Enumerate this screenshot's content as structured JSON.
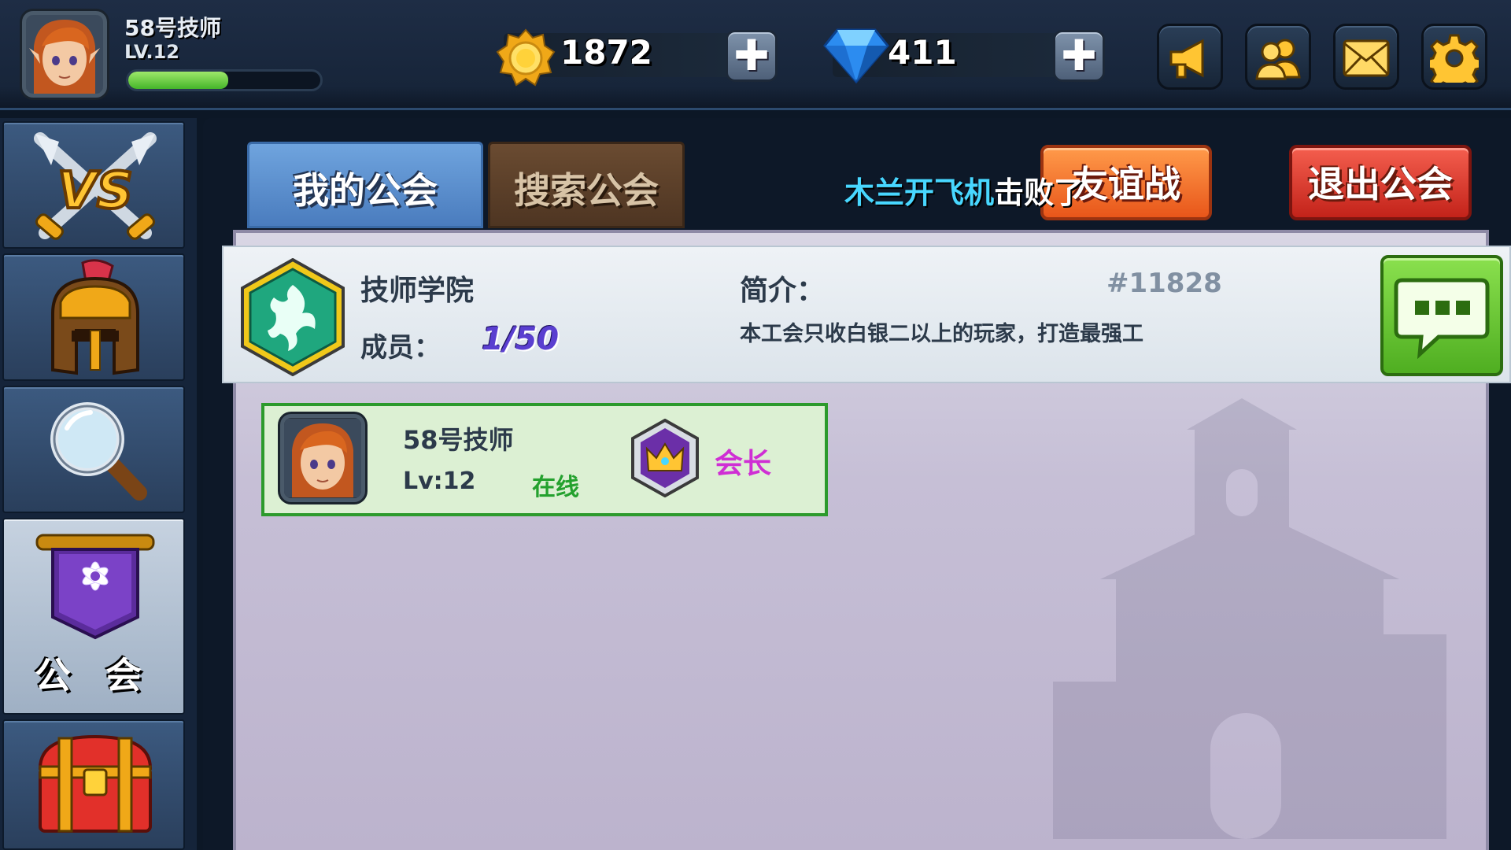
{
  "player": {
    "name": "58号技师",
    "level": "LV.12",
    "xp_fraction": 0.52
  },
  "currency": {
    "gold": "1872",
    "diamonds": "411",
    "plus_symbol": "✚"
  },
  "top_icons": [
    "megaphone-icon",
    "friends-icon",
    "mail-icon",
    "settings-gear-icon"
  ],
  "sidebar": {
    "items": [
      {
        "name": "battle-vs",
        "icon": "vs-swords-icon",
        "label": ""
      },
      {
        "name": "heroes",
        "icon": "helmet-icon",
        "label": ""
      },
      {
        "name": "search",
        "icon": "magnifier-icon",
        "label": ""
      },
      {
        "name": "guild",
        "icon": "guild-banner-icon",
        "label": "公 会",
        "active": true
      },
      {
        "name": "chest",
        "icon": "treasure-chest-icon",
        "label": ""
      }
    ]
  },
  "tabs": {
    "my_guild": "我的公会",
    "search_guild": "搜索公会"
  },
  "scroll_message": {
    "name": "木兰开飞机",
    "text": "击败了"
  },
  "buttons": {
    "friendly_battle": "友谊战",
    "quit_guild": "退出公会"
  },
  "guild": {
    "name": "技师学院",
    "members_label": "成员：",
    "members_value": "1/50",
    "intro_label": "简介：",
    "id": "#11828",
    "intro_text": "本工会只收白银二以上的玩家，打造最强工"
  },
  "members": [
    {
      "name": "58号技师",
      "level": "Lv:12",
      "status": "在线",
      "role": "会长"
    }
  ],
  "colors": {
    "accent_blue": "#4a7cbe",
    "quit_red": "#c3231a",
    "friendly_orange": "#e8561a",
    "chat_green": "#4fae21",
    "online_green": "#24a12e",
    "role_magenta": "#cf2fd4"
  }
}
